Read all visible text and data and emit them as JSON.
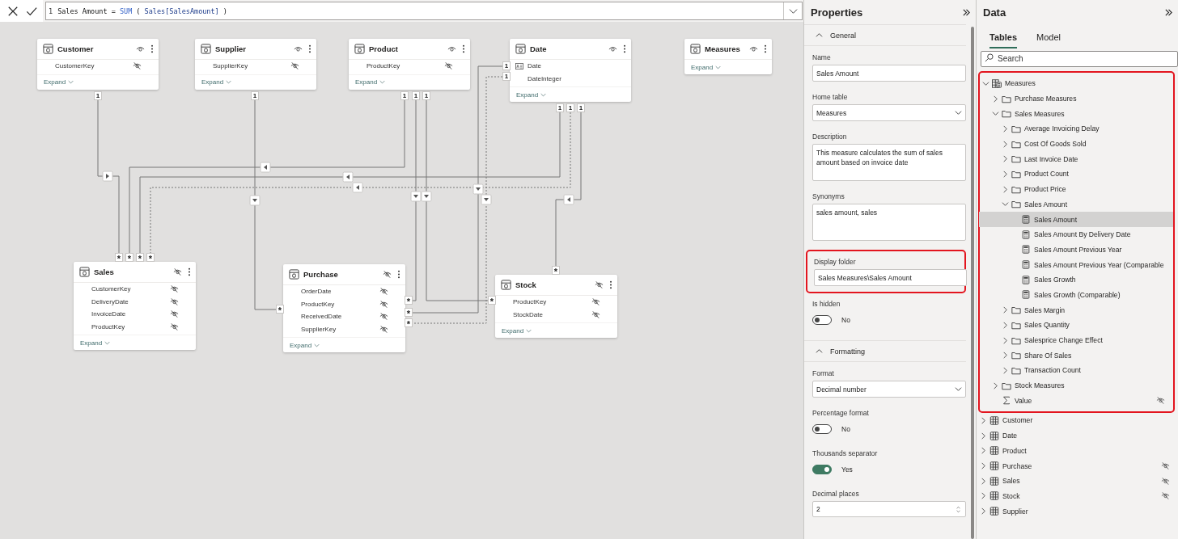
{
  "formula_bar": {
    "line_number": "1",
    "tokens": [
      {
        "text": "Sales Amount = ",
        "kind": "plain"
      },
      {
        "text": "SUM",
        "kind": "function"
      },
      {
        "text": " ( ",
        "kind": "plain"
      },
      {
        "text": "Sales[SalesAmount]",
        "kind": "reference"
      },
      {
        "text": " )",
        "kind": "plain"
      }
    ]
  },
  "diagram": {
    "tables": [
      {
        "name": "Customer",
        "hidden": false,
        "columns": [
          {
            "name": "CustomerKey",
            "hidden": true,
            "kind": "field"
          }
        ],
        "expand_label": "Expand"
      },
      {
        "name": "Supplier",
        "hidden": false,
        "columns": [
          {
            "name": "SupplierKey",
            "hidden": true,
            "kind": "field"
          }
        ],
        "expand_label": "Expand"
      },
      {
        "name": "Product",
        "hidden": false,
        "columns": [
          {
            "name": "ProductKey",
            "hidden": true,
            "kind": "field"
          }
        ],
        "expand_label": "Expand"
      },
      {
        "name": "Date",
        "hidden": false,
        "columns": [
          {
            "name": "Date",
            "hidden": false,
            "kind": "date_key"
          },
          {
            "name": "DateInteger",
            "hidden": false,
            "kind": "field"
          }
        ],
        "expand_label": "Expand"
      },
      {
        "name": "Measures",
        "hidden": false,
        "expand_label": "Expand"
      },
      {
        "name": "Sales",
        "hidden": true,
        "columns": [
          {
            "name": "CustomerKey",
            "hidden": true,
            "kind": "field"
          },
          {
            "name": "DeliveryDate",
            "hidden": true,
            "kind": "field"
          },
          {
            "name": "InvoiceDate",
            "hidden": true,
            "kind": "field"
          },
          {
            "name": "ProductKey",
            "hidden": true,
            "kind": "field"
          }
        ],
        "expand_label": "Expand"
      },
      {
        "name": "Purchase",
        "hidden": true,
        "columns": [
          {
            "name": "OrderDate",
            "hidden": true,
            "kind": "field"
          },
          {
            "name": "ProductKey",
            "hidden": true,
            "kind": "field"
          },
          {
            "name": "ReceivedDate",
            "hidden": true,
            "kind": "field"
          },
          {
            "name": "SupplierKey",
            "hidden": true,
            "kind": "field"
          }
        ],
        "expand_label": "Expand"
      },
      {
        "name": "Stock",
        "hidden": true,
        "columns": [
          {
            "name": "ProductKey",
            "hidden": true,
            "kind": "field"
          },
          {
            "name": "StockDate",
            "hidden": true,
            "kind": "field"
          }
        ],
        "expand_label": "Expand"
      }
    ],
    "relationships": [
      {
        "one_label": "1",
        "many_label": "*",
        "active": true
      },
      {
        "one_label": "1",
        "many_label": "*",
        "active": true
      },
      {
        "one_label": "1",
        "many_label": "*",
        "active": true
      },
      {
        "one_label": "1",
        "many_label": "*",
        "active": false
      },
      {
        "one_label": "1",
        "many_label": "*",
        "active": true
      },
      {
        "one_label": "1",
        "many_label": "*",
        "active": true
      },
      {
        "one_label": "1",
        "many_label": "*",
        "active": true
      },
      {
        "one_label": "1",
        "many_label": "*",
        "active": true
      },
      {
        "one_label": "1",
        "many_label": "*",
        "active": false
      },
      {
        "one_label": "1",
        "many_label": "*",
        "active": true
      }
    ]
  },
  "properties": {
    "title": "Properties",
    "sections": [
      {
        "title": "General",
        "expanded": true,
        "fields": [
          {
            "kind": "text",
            "label": "Name",
            "value": "Sales Amount",
            "highlighted": false
          },
          {
            "kind": "select",
            "label": "Home table",
            "value": "Measures",
            "highlighted": false
          },
          {
            "kind": "textarea",
            "label": "Description",
            "value": "This measure calculates the sum of sales amount based on invoice date",
            "highlighted": false
          },
          {
            "kind": "textarea",
            "label": "Synonyms",
            "value": "sales amount, sales",
            "highlighted": false
          },
          {
            "kind": "text",
            "label": "Display folder",
            "value": "Sales Measures\\Sales Amount",
            "highlighted": true
          },
          {
            "kind": "toggle",
            "label": "Is hidden",
            "on": false,
            "value": "No",
            "highlighted": false
          }
        ]
      },
      {
        "title": "Formatting",
        "expanded": true,
        "fields": [
          {
            "kind": "select",
            "label": "Format",
            "value": "Decimal number",
            "highlighted": false
          },
          {
            "kind": "toggle",
            "label": "Percentage format",
            "on": false,
            "value": "No",
            "highlighted": false
          },
          {
            "kind": "toggle",
            "label": "Thousands separator",
            "on": true,
            "value": "Yes",
            "highlighted": false
          },
          {
            "kind": "spinner",
            "label": "Decimal places",
            "value": "2",
            "highlighted": false
          }
        ]
      }
    ]
  },
  "data_panel": {
    "title": "Data",
    "tabs": [
      {
        "label": "Tables",
        "selected": true
      },
      {
        "label": "Model",
        "selected": false
      }
    ],
    "search": {
      "placeholder": "Search"
    },
    "tree": [
      {
        "label": "Measures",
        "kind": "measure_table",
        "expanded": true,
        "selected": false,
        "hidden": false,
        "highlighted": true,
        "children": [
          {
            "label": "Purchase Measures",
            "kind": "folder",
            "expanded": false,
            "selected": false,
            "hidden": false
          },
          {
            "label": "Sales Measures",
            "kind": "folder",
            "expanded": true,
            "selected": false,
            "hidden": false,
            "children": [
              {
                "label": "Average Invoicing Delay",
                "kind": "folder",
                "expanded": false,
                "selected": false,
                "hidden": false
              },
              {
                "label": "Cost Of Goods Sold",
                "kind": "folder",
                "expanded": false,
                "selected": false,
                "hidden": false
              },
              {
                "label": "Last Invoice Date",
                "kind": "folder",
                "expanded": false,
                "selected": false,
                "hidden": false
              },
              {
                "label": "Product Count",
                "kind": "folder",
                "expanded": false,
                "selected": false,
                "hidden": false
              },
              {
                "label": "Product Price",
                "kind": "folder",
                "expanded": false,
                "selected": false,
                "hidden": false
              },
              {
                "label": "Sales Amount",
                "kind": "folder",
                "expanded": true,
                "selected": false,
                "hidden": false,
                "children": [
                  {
                    "label": "Sales Amount",
                    "kind": "measure",
                    "selected": true,
                    "hidden": false
                  },
                  {
                    "label": "Sales Amount By Delivery Date",
                    "kind": "measure",
                    "selected": false,
                    "hidden": false
                  },
                  {
                    "label": "Sales Amount Previous Year",
                    "kind": "measure",
                    "selected": false,
                    "hidden": false
                  },
                  {
                    "label": "Sales Amount Previous Year (Comparable",
                    "kind": "measure",
                    "selected": false,
                    "hidden": false
                  },
                  {
                    "label": "Sales Growth",
                    "kind": "measure",
                    "selected": false,
                    "hidden": false
                  },
                  {
                    "label": "Sales Growth (Comparable)",
                    "kind": "measure",
                    "selected": false,
                    "hidden": false
                  }
                ]
              },
              {
                "label": "Sales Margin",
                "kind": "folder",
                "expanded": false,
                "selected": false,
                "hidden": false
              },
              {
                "label": "Sales Quantity",
                "kind": "folder",
                "expanded": false,
                "selected": false,
                "hidden": false
              },
              {
                "label": "Salesprice Change Effect",
                "kind": "folder",
                "expanded": false,
                "selected": false,
                "hidden": false
              },
              {
                "label": "Share Of Sales",
                "kind": "folder",
                "expanded": false,
                "selected": false,
                "hidden": false
              },
              {
                "label": "Transaction Count",
                "kind": "folder",
                "expanded": false,
                "selected": false,
                "hidden": false
              }
            ]
          },
          {
            "label": "Stock Measures",
            "kind": "folder",
            "expanded": false,
            "selected": false,
            "hidden": false
          },
          {
            "label": "Value",
            "kind": "column",
            "selected": false,
            "hidden": true
          }
        ]
      },
      {
        "label": "Customer",
        "kind": "table",
        "expanded": false,
        "selected": false,
        "hidden": false,
        "highlighted": false
      },
      {
        "label": "Date",
        "kind": "table",
        "expanded": false,
        "selected": false,
        "hidden": false,
        "highlighted": false
      },
      {
        "label": "Product",
        "kind": "table",
        "expanded": false,
        "selected": false,
        "hidden": false,
        "highlighted": false
      },
      {
        "label": "Purchase",
        "kind": "table",
        "expanded": false,
        "selected": false,
        "hidden": true,
        "highlighted": false
      },
      {
        "label": "Sales",
        "kind": "table",
        "expanded": false,
        "selected": false,
        "hidden": true,
        "highlighted": false
      },
      {
        "label": "Stock",
        "kind": "table",
        "expanded": false,
        "selected": false,
        "hidden": true,
        "highlighted": false
      },
      {
        "label": "Supplier",
        "kind": "table",
        "expanded": false,
        "selected": false,
        "hidden": false,
        "highlighted": false
      }
    ]
  }
}
